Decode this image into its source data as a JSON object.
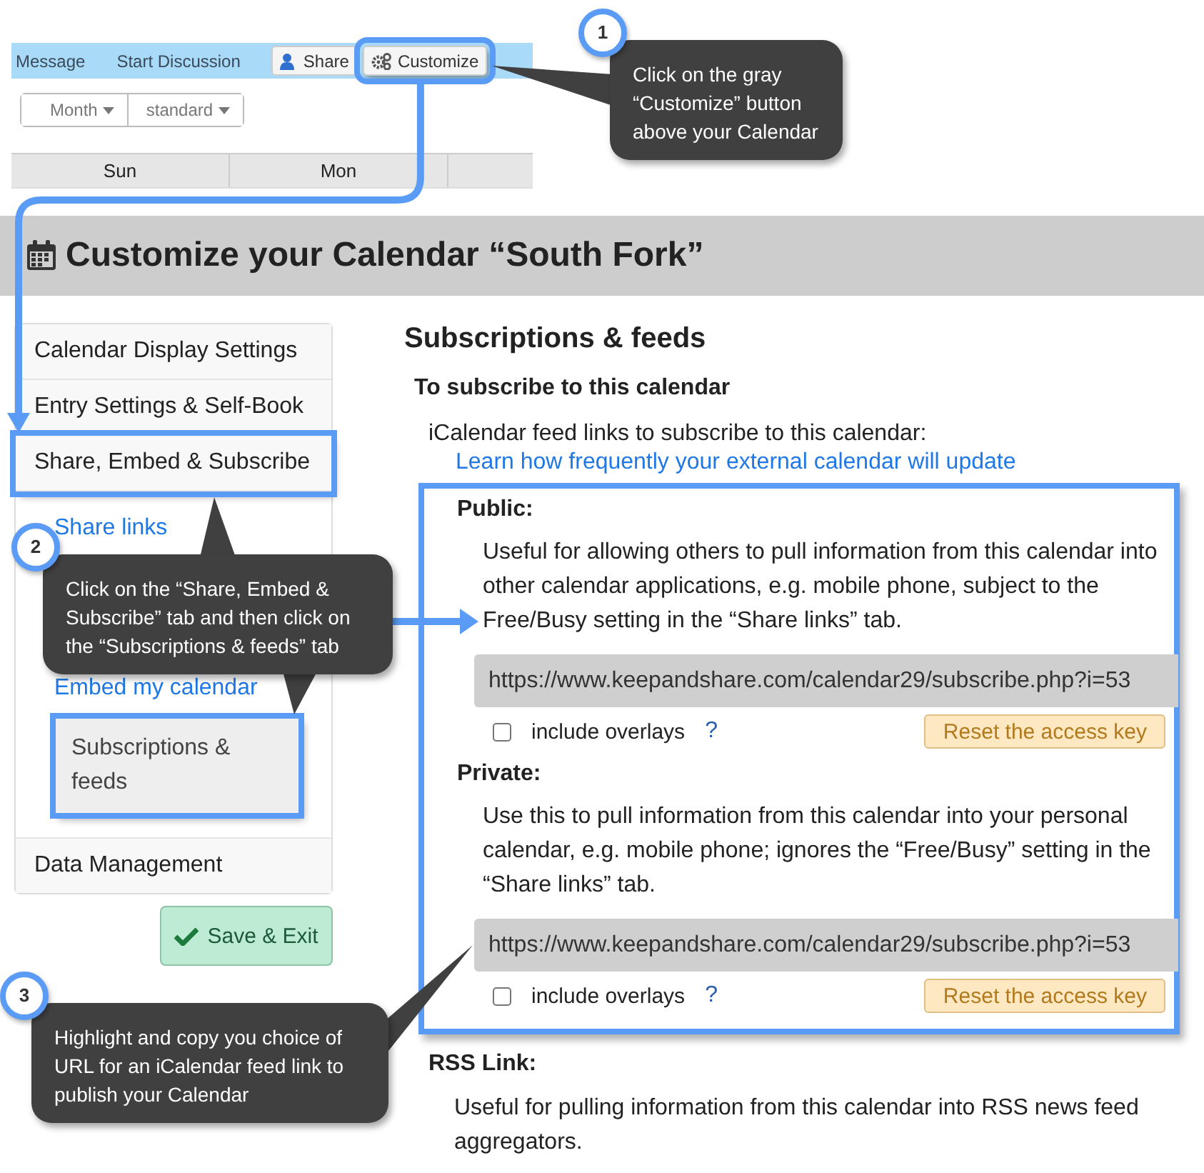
{
  "top_toolbar": {
    "items": [
      {
        "label": "Message",
        "kind": "link",
        "highlighted": false
      },
      {
        "label": "Start Discussion",
        "kind": "link",
        "highlighted": false
      },
      {
        "label": "Share",
        "kind": "share",
        "highlighted": false
      },
      {
        "label": "Customize",
        "kind": "customize",
        "highlighted": true
      }
    ]
  },
  "view_controls": [
    {
      "label": "Month"
    },
    {
      "label": "standard"
    }
  ],
  "day_headers": [
    "Sun",
    "Mon"
  ],
  "page_title": "Customize your Calendar “South Fork”",
  "sidebar": {
    "items": [
      {
        "label": "Calendar Display Settings",
        "highlighted": false
      },
      {
        "label": "Entry Settings & Self-Book",
        "highlighted": false
      },
      {
        "label": "Share, Embed & Subscribe",
        "highlighted": true,
        "children": [
          {
            "label": "Share links",
            "selected": false,
            "highlighted": false
          },
          {
            "label": "Embed my calendar",
            "selected": false,
            "highlighted": false
          },
          {
            "label": "Subscriptions & feeds",
            "selected": true,
            "highlighted": true
          }
        ]
      },
      {
        "label": "Data Management",
        "highlighted": false
      }
    ]
  },
  "save_button": "Save & Exit",
  "main": {
    "heading": "Subscriptions & feeds",
    "subheading": "To subscribe to this calendar",
    "intro": "iCalendar feed links to subscribe to this calendar:",
    "help_link": "Learn how frequently your external calendar will update",
    "feeds_highlighted": true,
    "feeds": [
      {
        "title": "Public:",
        "description": "Useful for allowing others to pull information from this calendar into other calendar applications, e.g. mobile phone, subject to the Free/Busy setting in the “Share links” tab.",
        "url": "https://www.keepandshare.com/calendar29/subscribe.php?i=53",
        "overlays_label": "include overlays",
        "overlays_checked": false,
        "help": "?",
        "reset_button": "Reset the access key"
      },
      {
        "title": "Private:",
        "description": "Use this to pull information from this calendar into your personal calendar, e.g. mobile phone; ignores the “Free/Busy” setting in the “Share links” tab.",
        "url": "https://www.keepandshare.com/calendar29/subscribe.php?i=53",
        "overlays_label": "include overlays",
        "overlays_checked": false,
        "help": "?",
        "reset_button": "Reset the access key"
      }
    ],
    "rss": {
      "title": "RSS Link:",
      "description": "Useful for pulling information from this calendar into RSS news feed aggregators."
    }
  },
  "callouts": [
    {
      "number": "1",
      "text": "Click on the gray “Customize” button above your Calendar"
    },
    {
      "number": "2",
      "text": "Click on the “Share, Embed & Subscribe” tab and then click on the “Subscriptions & feeds” tab"
    },
    {
      "number": "3",
      "text": "Highlight and copy you choice of URL for an iCalendar feed link to publish your Calendar"
    }
  ]
}
